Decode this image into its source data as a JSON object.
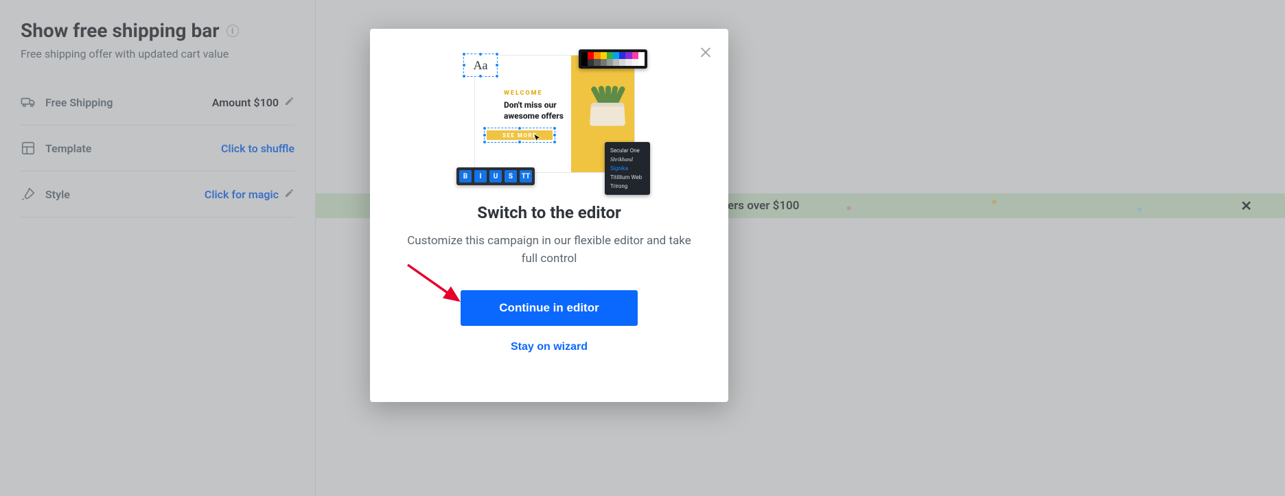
{
  "sidebar": {
    "title": "Show free shipping bar",
    "subtitle": "Free shipping offer with updated cart value",
    "options": {
      "shipping": {
        "label": "Free Shipping",
        "value": "Amount $100"
      },
      "template": {
        "label": "Template",
        "action": "Click to shuffle"
      },
      "style": {
        "label": "Style",
        "action": "Click for magic"
      }
    }
  },
  "preview_bar": {
    "text_suffix": "ers over $100"
  },
  "modal": {
    "title": "Switch to the editor",
    "description": "Customize this campaign in our flexible editor and take full control",
    "primary_button": "Continue in editor",
    "secondary_button": "Stay on wizard",
    "illustration": {
      "text_sample": "Aa",
      "welcome": "WELCOME",
      "tagline_line1": "Don't miss our",
      "tagline_line2": "awesome offers",
      "cta": "SEE MORE",
      "toolbar": [
        "B",
        "I",
        "U",
        "S",
        "TT"
      ],
      "fonts": [
        "Secular One",
        "Shrikhand",
        "Signika",
        "Titillium Web",
        "Trirong"
      ],
      "palette_colors": [
        "#000000",
        "#ff0000",
        "#ff8c00",
        "#ffd400",
        "#3cb043",
        "#00a2ff",
        "#2b2fd8",
        "#8a2be2",
        "#ff3ea5",
        "#ffffff"
      ],
      "gray_row": [
        "#000000",
        "#333333",
        "#555555",
        "#777777",
        "#999999",
        "#bbbbbb",
        "#d6d6d6",
        "#e8e8e8",
        "#f4f4f4",
        "#ffffff"
      ]
    }
  }
}
